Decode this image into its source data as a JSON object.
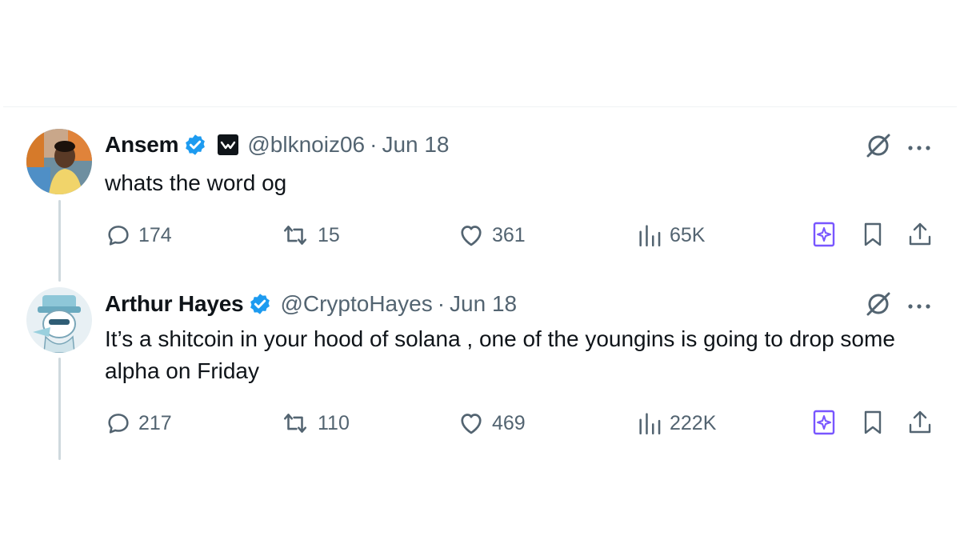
{
  "tweets": [
    {
      "name": "Ansem",
      "handle": "@blknoiz06",
      "separator": "·",
      "date": "Jun 18",
      "text": "whats the word og",
      "stats": {
        "replies": "174",
        "reposts": "15",
        "likes": "361",
        "views": "65K"
      }
    },
    {
      "name": "Arthur Hayes",
      "handle": "@CryptoHayes",
      "separator": "·",
      "date": "Jun 18",
      "text": "It’s a shitcoin in your hood of solana , one of the youngins is going to drop some alpha on Friday",
      "stats": {
        "replies": "217",
        "reposts": "110",
        "likes": "469",
        "views": "222K"
      }
    }
  ],
  "icons": [
    "verified-badge-icon",
    "affiliate-badge-icon",
    "grok-icon",
    "more-icon",
    "reply-icon",
    "repost-icon",
    "like-icon",
    "views-icon",
    "grok-bookmark-icon",
    "bookmark-icon",
    "share-icon"
  ],
  "colors": {
    "accent": "#1d9bf0",
    "muted": "#536471",
    "grok_purple": "#7856ff",
    "thread_line": "#cfd9de"
  }
}
